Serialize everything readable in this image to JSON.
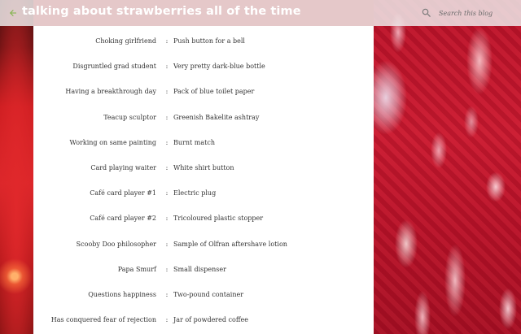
{
  "blog": {
    "title": "talking about strawberries all of the time"
  },
  "search": {
    "placeholder": "Search this blog",
    "icon": "search-icon"
  },
  "nav": {
    "back_icon": "back-arrow-icon",
    "accent": "#7cb342"
  },
  "colors": {
    "background_strawberry": "#b01518",
    "content_bg": "#ffffff",
    "topbar_bg": "#f0f0f0"
  },
  "separator": ":",
  "rows": [
    {
      "role": "Choking girlfriend",
      "object": "Push button for a bell"
    },
    {
      "role": "Disgruntled grad student",
      "object": "Very pretty dark-blue bottle"
    },
    {
      "role": "Having a breakthrough day",
      "object": "Pack of blue toilet paper"
    },
    {
      "role": "Teacup sculptor",
      "object": "Greenish Bakelite ashtray"
    },
    {
      "role": "Working on same painting",
      "object": "Burnt match"
    },
    {
      "role": "Card playing waiter",
      "object": "White shirt button"
    },
    {
      "role": "Café card player #1",
      "object": "Electric plug"
    },
    {
      "role": "Café card player #2",
      "object": "Tricoloured plastic stopper"
    },
    {
      "role": "Scooby Doo philosopher",
      "object": "Sample of Olfran aftershave lotion"
    },
    {
      "role": "Papa Smurf",
      "object": "Small dispenser"
    },
    {
      "role": "Questions happiness",
      "object": "Two-pound container"
    },
    {
      "role": "Has conquered fear of rejection",
      "object": "Jar of powdered coffee"
    }
  ]
}
